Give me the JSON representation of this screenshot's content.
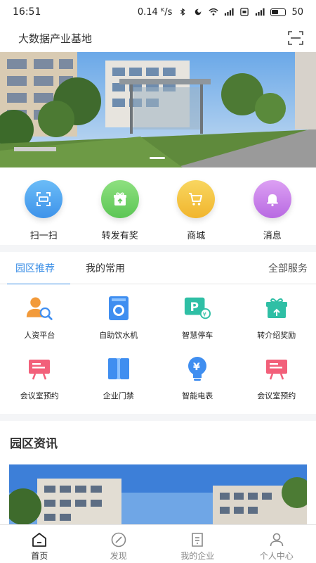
{
  "status_bar": {
    "time": "16:51",
    "speed": "0.14 ᴷ/s",
    "battery": "50"
  },
  "header": {
    "title": "大数据产业基地",
    "scan_icon": "scan-frame-icon"
  },
  "quick_actions": [
    {
      "label": "扫一扫",
      "icon": "scan-icon",
      "color": "#4aa3f0"
    },
    {
      "label": "转发有奖",
      "icon": "gift-icon",
      "color": "#6fd36a"
    },
    {
      "label": "商城",
      "icon": "cart-icon",
      "color": "#f3c33f"
    },
    {
      "label": "消息",
      "icon": "bell-icon",
      "color": "#c97fe8"
    }
  ],
  "tabs": {
    "items": [
      "园区推荐",
      "我的常用"
    ],
    "active": "园区推荐",
    "all_services": "全部服务"
  },
  "services": [
    {
      "label": "人资平台",
      "icon": "person-search-icon"
    },
    {
      "label": "自助饮水机",
      "icon": "water-dispenser-icon"
    },
    {
      "label": "智慧停车",
      "icon": "parking-icon"
    },
    {
      "label": "转介绍奖励",
      "icon": "gift-reward-icon"
    },
    {
      "label": "会议室预约",
      "icon": "presentation-icon"
    },
    {
      "label": "企业门禁",
      "icon": "door-access-icon"
    },
    {
      "label": "智能电表",
      "icon": "bulb-meter-icon"
    },
    {
      "label": "会议室预约",
      "icon": "presentation-icon"
    }
  ],
  "news": {
    "title": "园区资讯"
  },
  "bottom_nav": [
    {
      "label": "首页",
      "icon": "home-icon",
      "active": true
    },
    {
      "label": "发现",
      "icon": "compass-icon",
      "active": false
    },
    {
      "label": "我的企业",
      "icon": "company-doc-icon",
      "active": false
    },
    {
      "label": "个人中心",
      "icon": "user-icon",
      "active": false
    }
  ],
  "colors": {
    "accent": "#3a8ee6",
    "service_orange": "#f29a3a",
    "service_blue": "#3f8ef0",
    "service_teal": "#2fbfa5",
    "service_pink": "#f2607a"
  }
}
